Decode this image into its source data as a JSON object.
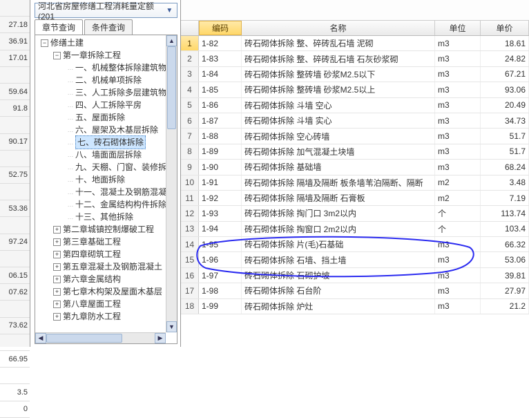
{
  "left_numbers": [
    "",
    "27.18",
    "36.91",
    "17.01",
    "",
    "59.64",
    "91.8",
    "",
    "90.17",
    "",
    "52.75",
    "",
    "53.36",
    "",
    "97.24",
    "",
    "06.15",
    "07.62",
    "",
    "73.62",
    "",
    "66.95",
    "",
    "3.5",
    "0"
  ],
  "dropdown": {
    "label": "河北省房屋修缮工程消耗量定额(201"
  },
  "tabs": {
    "active": "章节查询",
    "inactive": "条件查询"
  },
  "tree": [
    {
      "indent": 0,
      "tw": "-",
      "label": "修缮土建"
    },
    {
      "indent": 1,
      "tw": "-",
      "label": "第一章拆除工程"
    },
    {
      "indent": 2,
      "tw": "",
      "label": "一、机械整体拆除建筑物"
    },
    {
      "indent": 2,
      "tw": "",
      "label": "二、机械单项拆除"
    },
    {
      "indent": 2,
      "tw": "",
      "label": "三、人工拆除多层建筑物"
    },
    {
      "indent": 2,
      "tw": "",
      "label": "四、人工拆除平房"
    },
    {
      "indent": 2,
      "tw": "",
      "label": "五、屋面拆除"
    },
    {
      "indent": 2,
      "tw": "",
      "label": "六、屋架及木基层拆除"
    },
    {
      "indent": 2,
      "tw": "",
      "label": "七、砖石砌体拆除",
      "sel": true
    },
    {
      "indent": 2,
      "tw": "",
      "label": "八、墙面面层拆除"
    },
    {
      "indent": 2,
      "tw": "",
      "label": "九、天棚、门窗、装修拆除"
    },
    {
      "indent": 2,
      "tw": "",
      "label": "十、地面拆除"
    },
    {
      "indent": 2,
      "tw": "",
      "label": "十一、混凝土及钢筋混凝"
    },
    {
      "indent": 2,
      "tw": "",
      "label": "十二、金属结构构件拆除"
    },
    {
      "indent": 2,
      "tw": "",
      "label": "十三、其他拆除"
    },
    {
      "indent": 1,
      "tw": "+",
      "label": "第二章城镇控制爆破工程"
    },
    {
      "indent": 1,
      "tw": "+",
      "label": "第三章基础工程"
    },
    {
      "indent": 1,
      "tw": "+",
      "label": "第四章砌筑工程"
    },
    {
      "indent": 1,
      "tw": "+",
      "label": "第五章混凝土及钢筋混凝土"
    },
    {
      "indent": 1,
      "tw": "+",
      "label": "第六章金属结构"
    },
    {
      "indent": 1,
      "tw": "+",
      "label": "第七章木构架及屋面木基层"
    },
    {
      "indent": 1,
      "tw": "+",
      "label": "第八章屋面工程"
    },
    {
      "indent": 1,
      "tw": "+",
      "label": "第九章防水工程"
    }
  ],
  "grid": {
    "headers": {
      "code": "编码",
      "name": "名称",
      "unit": "单位",
      "price": "单价"
    },
    "rows": [
      {
        "idx": "1",
        "code": "1-82",
        "name": "砖石砌体拆除  整、碎砖乱石墙  泥砌",
        "unit": "m3",
        "price": "18.61"
      },
      {
        "idx": "2",
        "code": "1-83",
        "name": "砖石砌体拆除  整、碎砖乱石墙  石灰砂浆砌",
        "unit": "m3",
        "price": "24.82"
      },
      {
        "idx": "3",
        "code": "1-84",
        "name": "砖石砌体拆除  整砖墙 砂浆M2.5以下",
        "unit": "m3",
        "price": "67.21"
      },
      {
        "idx": "4",
        "code": "1-85",
        "name": "砖石砌体拆除  整砖墙 砂浆M2.5以上",
        "unit": "m3",
        "price": "93.06"
      },
      {
        "idx": "5",
        "code": "1-86",
        "name": "砖石砌体拆除  斗墙  空心",
        "unit": "m3",
        "price": "20.49"
      },
      {
        "idx": "6",
        "code": "1-87",
        "name": "砖石砌体拆除  斗墙  实心",
        "unit": "m3",
        "price": "34.73"
      },
      {
        "idx": "7",
        "code": "1-88",
        "name": "砖石砌体拆除  空心砖墙",
        "unit": "m3",
        "price": "51.7"
      },
      {
        "idx": "8",
        "code": "1-89",
        "name": "砖石砌体拆除  加气混凝土块墙",
        "unit": "m3",
        "price": "51.7"
      },
      {
        "idx": "9",
        "code": "1-90",
        "name": "砖石砌体拆除  基础墙",
        "unit": "m3",
        "price": "68.24"
      },
      {
        "idx": "10",
        "code": "1-91",
        "name": "砖石砌体拆除  隔墙及隔断  板条墙苇泊隔断、隔断",
        "unit": "m2",
        "price": "3.48"
      },
      {
        "idx": "11",
        "code": "1-92",
        "name": "砖石砌体拆除  隔墙及隔断  石膏板",
        "unit": "m2",
        "price": "7.19"
      },
      {
        "idx": "12",
        "code": "1-93",
        "name": "砖石砌体拆除  掏门口  3m2以内",
        "unit": "个",
        "price": "113.74"
      },
      {
        "idx": "13",
        "code": "1-94",
        "name": "砖石砌体拆除  掏窗口  2m2以内",
        "unit": "个",
        "price": "103.4"
      },
      {
        "idx": "14",
        "code": "1-95",
        "name": "砖石砌体拆除  片(毛)石基础",
        "unit": "m3",
        "price": "66.32"
      },
      {
        "idx": "15",
        "code": "1-96",
        "name": "砖石砌体拆除  石墙、挡土墙",
        "unit": "m3",
        "price": "53.06"
      },
      {
        "idx": "16",
        "code": "1-97",
        "name": "砖石砌体拆除  石砌护坡",
        "unit": "m3",
        "price": "39.81"
      },
      {
        "idx": "17",
        "code": "1-98",
        "name": "砖石砌体拆除  石台阶",
        "unit": "m3",
        "price": "27.97"
      },
      {
        "idx": "18",
        "code": "1-99",
        "name": "砖石砌体拆除  炉灶",
        "unit": "m3",
        "price": "21.2"
      }
    ]
  }
}
